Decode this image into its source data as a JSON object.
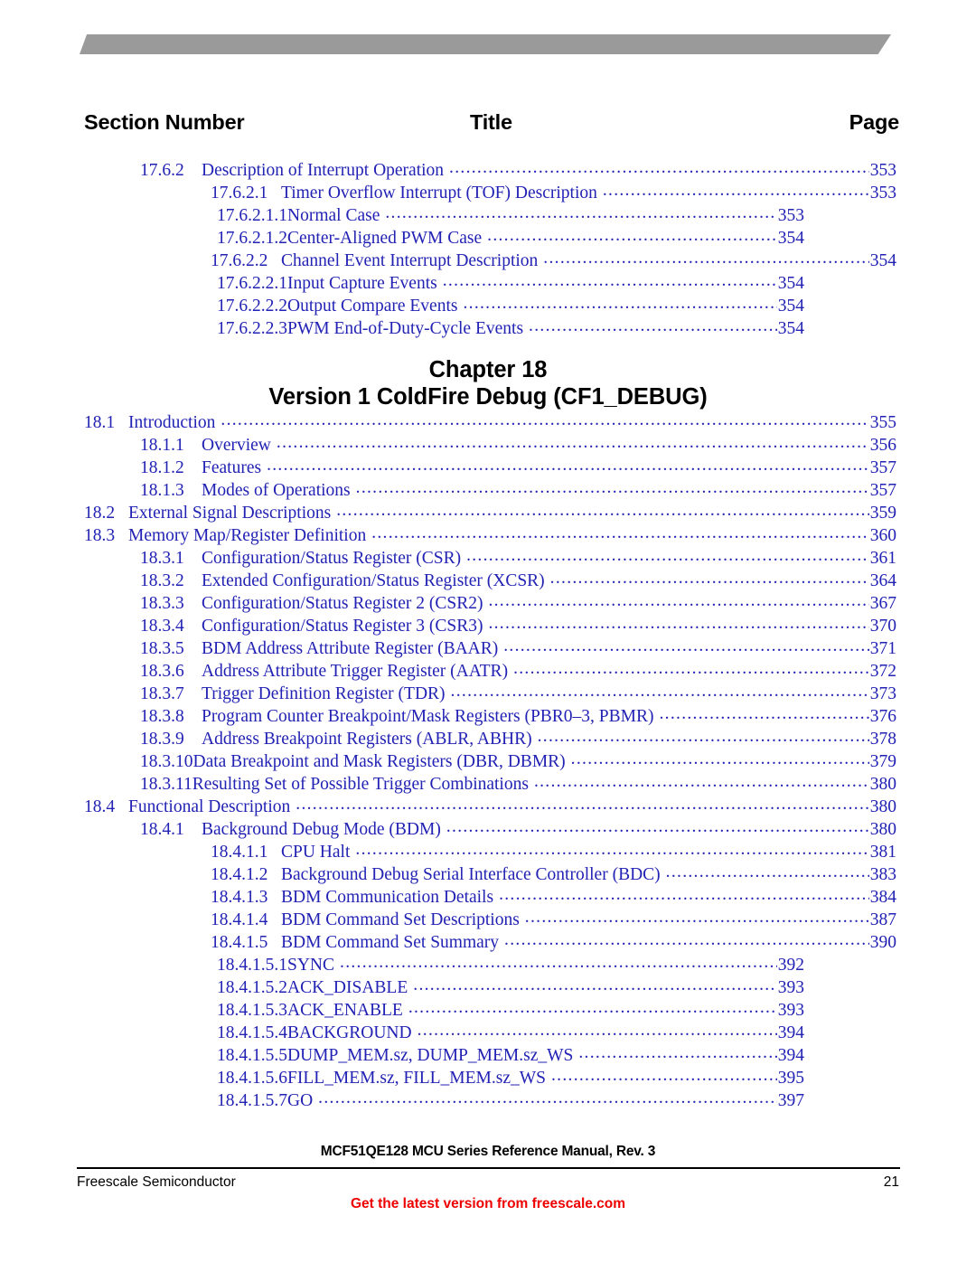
{
  "colors": {
    "toc_blue": "#2222b4",
    "banner_gray": "#9a9a9a",
    "promo_red": "#ee0000",
    "text_black": "#000000"
  },
  "headings": {
    "section_number": "Section Number",
    "title": "Title",
    "page": "Page"
  },
  "chapter": {
    "line1": "Chapter  18",
    "line2": "Version 1 ColdFire Debug (CF1_DEBUG)"
  },
  "toc_before_chapter": [
    {
      "level": 2,
      "num": "17.6.2",
      "title": "Description of Interrupt Operation",
      "page": "353",
      "tight": false
    },
    {
      "level": 3,
      "num": "17.6.2.1",
      "title": "Timer Overflow Interrupt (TOF) Description",
      "page": "353",
      "tight": false
    },
    {
      "level": 4,
      "num": "17.6.2.1.1",
      "title": "Normal Case",
      "page": "353",
      "tight": true
    },
    {
      "level": 4,
      "num": "17.6.2.1.2",
      "title": "Center-Aligned PWM Case",
      "page": "354",
      "tight": true
    },
    {
      "level": 3,
      "num": "17.6.2.2",
      "title": "Channel Event Interrupt Description",
      "page": "354",
      "tight": false
    },
    {
      "level": 4,
      "num": "17.6.2.2.1",
      "title": "Input Capture Events",
      "page": "354",
      "tight": true
    },
    {
      "level": 4,
      "num": "17.6.2.2.2",
      "title": "Output Compare Events",
      "page": "354",
      "tight": true
    },
    {
      "level": 4,
      "num": "17.6.2.2.3",
      "title": "PWM End-of-Duty-Cycle Events",
      "page": "354",
      "tight": true
    }
  ],
  "toc_after_chapter": [
    {
      "level": 1,
      "num": "18.1",
      "title": "Introduction",
      "page": "355",
      "tight": false
    },
    {
      "level": 2,
      "num": "18.1.1",
      "title": "Overview",
      "page": "356",
      "tight": false
    },
    {
      "level": 2,
      "num": "18.1.2",
      "title": "Features",
      "page": "357",
      "tight": false
    },
    {
      "level": 2,
      "num": "18.1.3",
      "title": "Modes of Operations",
      "page": "357",
      "tight": false
    },
    {
      "level": 1,
      "num": "18.2",
      "title": "External Signal Descriptions",
      "page": "359",
      "tight": false
    },
    {
      "level": 1,
      "num": "18.3",
      "title": "Memory Map/Register Definition",
      "page": "360",
      "tight": false
    },
    {
      "level": 2,
      "num": "18.3.1",
      "title": "Configuration/Status Register (CSR)",
      "page": "361",
      "tight": false
    },
    {
      "level": 2,
      "num": "18.3.2",
      "title": "Extended Configuration/Status Register (XCSR)",
      "page": "364",
      "tight": false
    },
    {
      "level": 2,
      "num": "18.3.3",
      "title": "Configuration/Status Register 2 (CSR2)",
      "page": "367",
      "tight": false
    },
    {
      "level": 2,
      "num": "18.3.4",
      "title": "Configuration/Status Register 3 (CSR3)",
      "page": "370",
      "tight": false
    },
    {
      "level": 2,
      "num": "18.3.5",
      "title": "BDM Address Attribute Register (BAAR)",
      "page": "371",
      "tight": false
    },
    {
      "level": 2,
      "num": "18.3.6",
      "title": "Address Attribute Trigger Register (AATR)",
      "page": "372",
      "tight": false
    },
    {
      "level": 2,
      "num": "18.3.7",
      "title": "Trigger Definition Register (TDR)",
      "page": "373",
      "tight": false
    },
    {
      "level": 2,
      "num": "18.3.8",
      "title": "Program Counter Breakpoint/Mask Registers (PBR0–3, PBMR)",
      "page": "376",
      "tight": false
    },
    {
      "level": 2,
      "num": "18.3.9",
      "title": "Address Breakpoint Registers (ABLR, ABHR)",
      "page": "378",
      "tight": false
    },
    {
      "level": 2,
      "num": "18.3.10",
      "title": "Data Breakpoint and Mask Registers (DBR, DBMR)",
      "page": "379",
      "tight": true
    },
    {
      "level": 2,
      "num": "18.3.11",
      "title": "Resulting Set of Possible Trigger Combinations",
      "page": "380",
      "tight": true
    },
    {
      "level": 1,
      "num": "18.4",
      "title": "Functional Description",
      "page": "380",
      "tight": false
    },
    {
      "level": 2,
      "num": "18.4.1",
      "title": "Background Debug Mode (BDM)",
      "page": "380",
      "tight": false
    },
    {
      "level": 3,
      "num": "18.4.1.1",
      "title": "CPU Halt",
      "page": "381",
      "tight": false
    },
    {
      "level": 3,
      "num": "18.4.1.2",
      "title": "Background Debug Serial Interface Controller (BDC)",
      "page": "383",
      "tight": false
    },
    {
      "level": 3,
      "num": "18.4.1.3",
      "title": "BDM Communication Details",
      "page": "384",
      "tight": false
    },
    {
      "level": 3,
      "num": "18.4.1.4",
      "title": "BDM Command Set Descriptions",
      "page": "387",
      "tight": false
    },
    {
      "level": 3,
      "num": "18.4.1.5",
      "title": "BDM Command Set Summary",
      "page": "390",
      "tight": false
    },
    {
      "level": 4,
      "num": "18.4.1.5.1",
      "title": "SYNC",
      "page": "392",
      "tight": true
    },
    {
      "level": 4,
      "num": "18.4.1.5.2",
      "title": "ACK_DISABLE",
      "page": "393",
      "tight": true
    },
    {
      "level": 4,
      "num": "18.4.1.5.3",
      "title": "ACK_ENABLE",
      "page": "393",
      "tight": true
    },
    {
      "level": 4,
      "num": "18.4.1.5.4",
      "title": "BACKGROUND",
      "page": "394",
      "tight": true
    },
    {
      "level": 4,
      "num": "18.4.1.5.5",
      "title": "DUMP_MEM.sz, DUMP_MEM.sz_WS",
      "page": "394",
      "tight": true
    },
    {
      "level": 4,
      "num": "18.4.1.5.6",
      "title": "FILL_MEM.sz, FILL_MEM.sz_WS",
      "page": "395",
      "tight": true
    },
    {
      "level": 4,
      "num": "18.4.1.5.7",
      "title": "GO",
      "page": "397",
      "tight": true
    }
  ],
  "footer": {
    "manual_title": "MCF51QE128 MCU Series Reference Manual, Rev.  3",
    "company": "Freescale Semiconductor",
    "page_number": "21",
    "promo": "Get the latest version from freescale.com"
  }
}
